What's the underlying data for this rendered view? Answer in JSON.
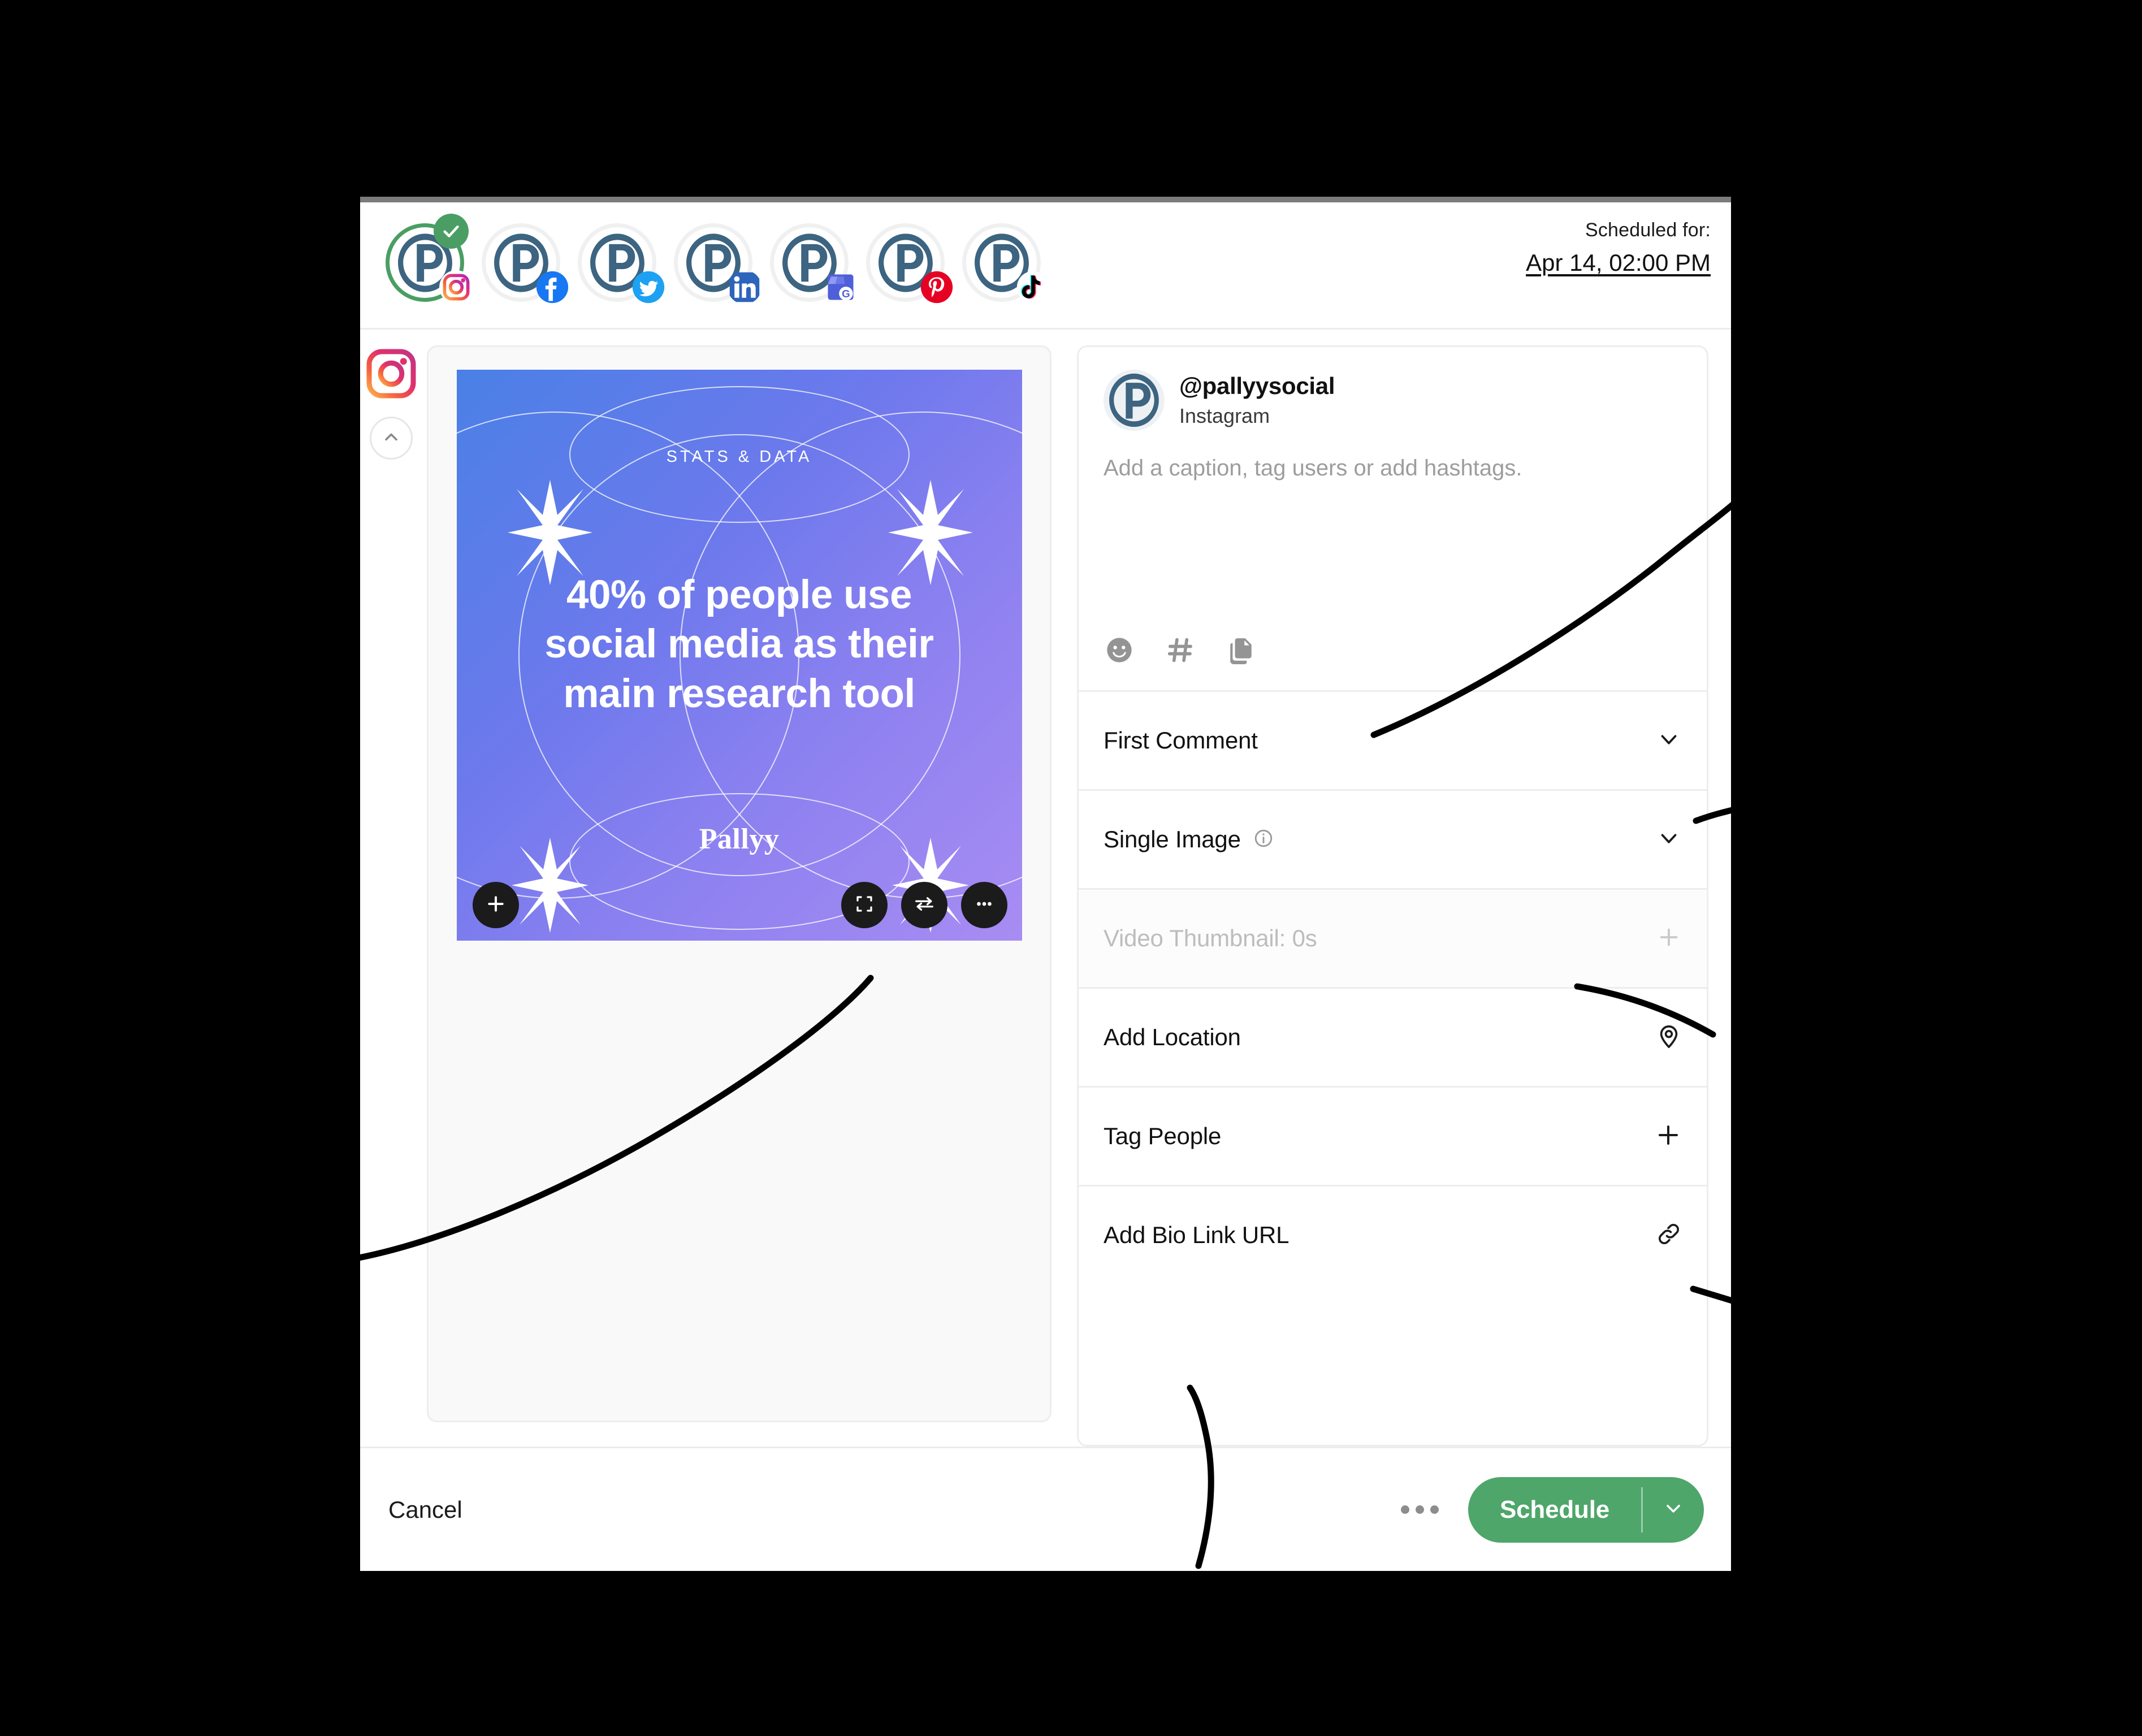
{
  "header": {
    "scheduled_label": "Scheduled for:",
    "scheduled_value": "Apr 14, 02:00 PM",
    "accounts": [
      {
        "name": "pallyy-instagram",
        "network": "instagram",
        "selected": true
      },
      {
        "name": "pallyy-facebook",
        "network": "facebook",
        "selected": false
      },
      {
        "name": "pallyy-twitter",
        "network": "twitter",
        "selected": false
      },
      {
        "name": "pallyy-linkedin",
        "network": "linkedin",
        "selected": false
      },
      {
        "name": "pallyy-google-business",
        "network": "google-business",
        "selected": false
      },
      {
        "name": "pallyy-pinterest",
        "network": "pinterest",
        "selected": false
      },
      {
        "name": "pallyy-tiktok",
        "network": "tiktok",
        "selected": false
      }
    ]
  },
  "rail": {
    "network_icon": "instagram-icon",
    "collapse_icon": "chevron-up-icon"
  },
  "preview": {
    "post": {
      "kicker": "STATS & DATA",
      "headline": "40% of people use social media as their main research tool",
      "brand": "Pallyy",
      "gradient_from": "#4A80E6",
      "gradient_to": "#A88CF2"
    },
    "buttons": [
      {
        "name": "add-media-button",
        "icon": "plus-icon"
      },
      {
        "name": "crop-image-button",
        "icon": "crop-icon"
      },
      {
        "name": "replace-image-button",
        "icon": "swap-arrows-icon"
      },
      {
        "name": "image-more-options-button",
        "icon": "more-horizontal-icon"
      }
    ]
  },
  "composer": {
    "account": {
      "handle": "@pallyysocial",
      "network": "Instagram",
      "avatar_icon": "pallyy-logo-icon"
    },
    "caption_placeholder": "Add a caption, tag users or add hashtags.",
    "caption_value": "",
    "tools": [
      {
        "name": "emoji-picker-button",
        "icon": "smiley-icon"
      },
      {
        "name": "hashtag-button",
        "icon": "hashtag-icon"
      },
      {
        "name": "saved-captions-button",
        "icon": "copy-icon"
      }
    ],
    "rows": [
      {
        "label": "First Comment",
        "icon": "chevron-down-icon",
        "name": "first-comment-row",
        "disabled": false,
        "info": false
      },
      {
        "label": "Single Image",
        "icon": "chevron-down-icon",
        "name": "single-image-row",
        "disabled": false,
        "info": true
      },
      {
        "label": "Video Thumbnail: 0s",
        "icon": "plus-icon",
        "name": "video-thumbnail-row",
        "disabled": true,
        "info": false
      },
      {
        "label": "Add Location",
        "icon": "map-pin-icon",
        "name": "add-location-row",
        "disabled": false,
        "info": false
      },
      {
        "label": "Tag People",
        "icon": "plus-icon",
        "name": "tag-people-row",
        "disabled": false,
        "info": false
      },
      {
        "label": "Add Bio Link URL",
        "icon": "link-icon",
        "name": "add-bio-link-row",
        "disabled": false,
        "info": false
      }
    ]
  },
  "footer": {
    "cancel_label": "Cancel",
    "more_icon": "more-horizontal-icon",
    "primary_label": "Schedule",
    "primary_caret_icon": "chevron-down-icon",
    "primary_color": "#4EA66A"
  }
}
